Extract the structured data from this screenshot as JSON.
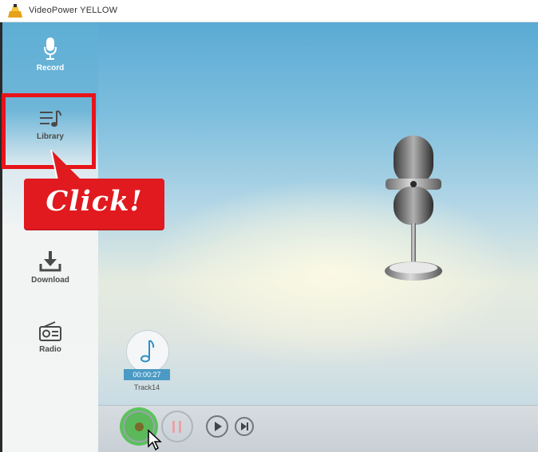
{
  "window": {
    "title": "VideoPower YELLOW"
  },
  "sidebar": {
    "items": [
      {
        "label": "Record",
        "icon": "microphone-icon"
      },
      {
        "label": "Library",
        "icon": "music-list-icon"
      },
      {
        "label": "Download",
        "icon": "download-icon"
      },
      {
        "label": "Radio",
        "icon": "radio-icon"
      }
    ]
  },
  "annotation": {
    "callout_text": "Click!",
    "color": "#e01a1f"
  },
  "track": {
    "time": "00:00:27",
    "name": "Track14",
    "icon": "music-note-icon"
  },
  "controls": {
    "record_icon": "record-icon",
    "pause_icon": "pause-icon",
    "play_icon": "play-icon",
    "next_icon": "next-icon"
  },
  "colors": {
    "sidebar_accent": "#5eaed5",
    "highlight": "#e8141a",
    "time_badge": "#4b9ac4"
  }
}
